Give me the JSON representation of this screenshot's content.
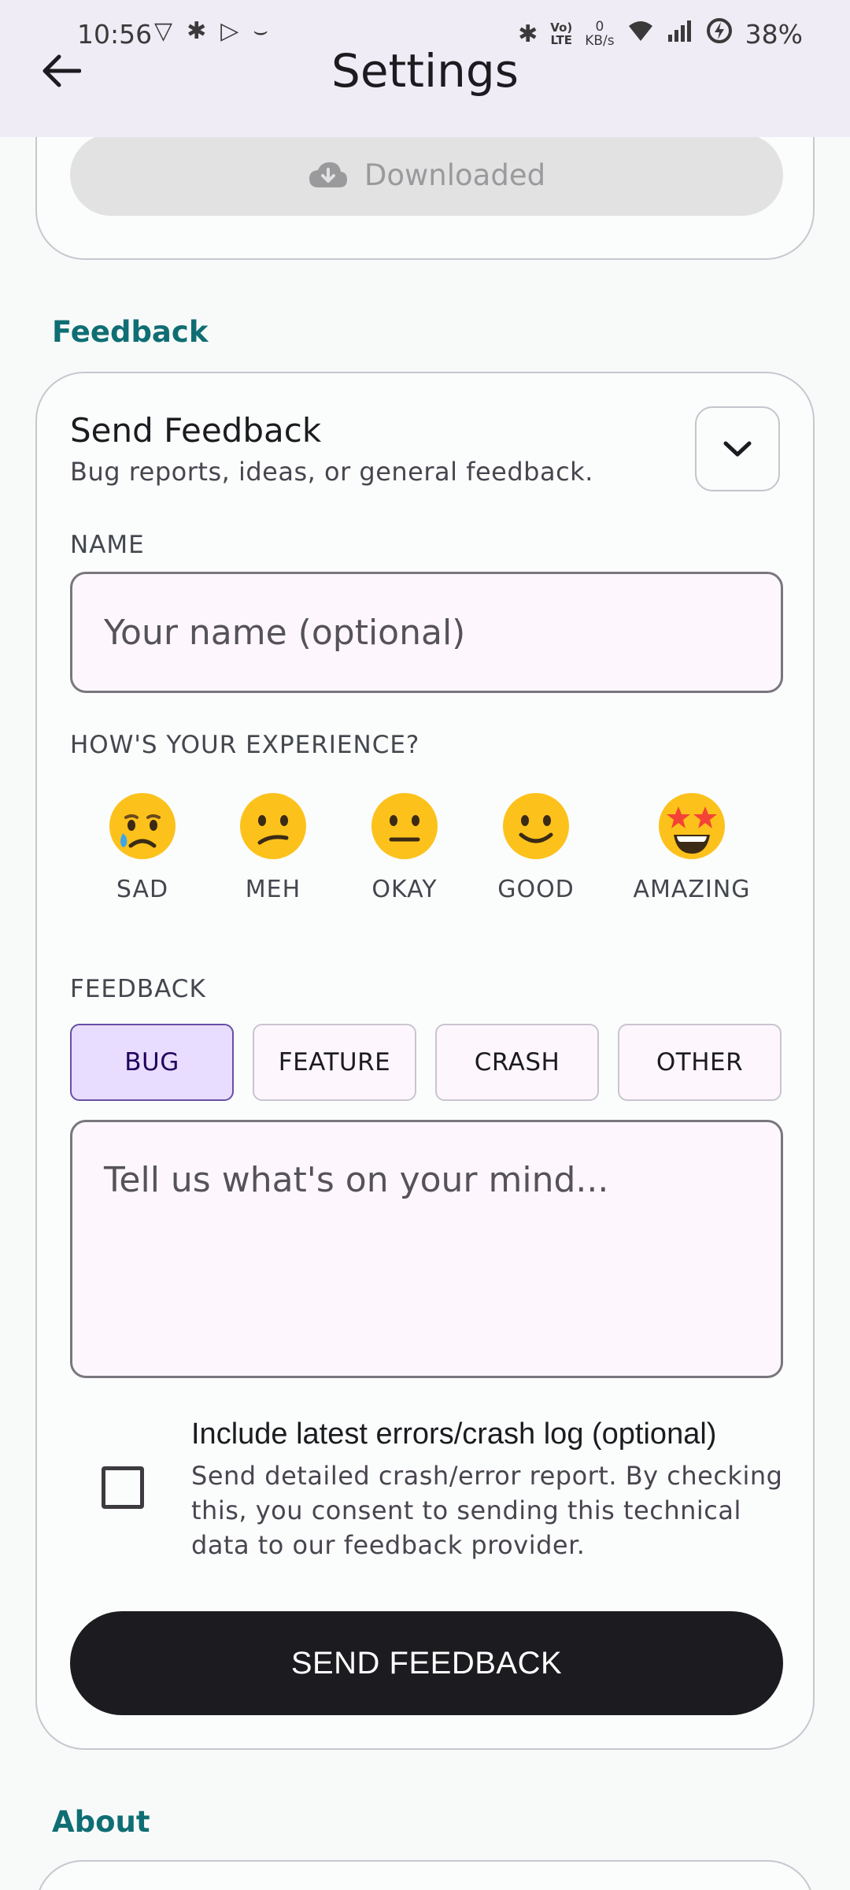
{
  "status_bar": {
    "time": "10:56",
    "net_speed_value": "0",
    "net_speed_unit": "KB/s",
    "volte_top": "Vo)",
    "volte_bottom": "LTE",
    "battery": "38%"
  },
  "app_bar": {
    "title": "Settings"
  },
  "download_card": {
    "button_label": "Downloaded"
  },
  "sections": {
    "feedback": "Feedback",
    "about": "About"
  },
  "feedback_card": {
    "title": "Send Feedback",
    "subtitle": "Bug reports, ideas, or general feedback.",
    "name_label": "NAME",
    "name_placeholder": "Your name (optional)",
    "experience_label": "HOW'S YOUR EXPERIENCE?",
    "experience_options": [
      {
        "label": "SAD",
        "icon": "sad-face-icon"
      },
      {
        "label": "MEH",
        "icon": "confused-face-icon"
      },
      {
        "label": "OKAY",
        "icon": "neutral-face-icon"
      },
      {
        "label": "GOOD",
        "icon": "smile-face-icon"
      },
      {
        "label": "AMAZING",
        "icon": "star-struck-face-icon"
      }
    ],
    "feedback_label": "FEEDBACK",
    "feedback_types": [
      {
        "label": "BUG",
        "selected": true
      },
      {
        "label": "FEATURE",
        "selected": false
      },
      {
        "label": "CRASH",
        "selected": false
      },
      {
        "label": "OTHER",
        "selected": false
      }
    ],
    "message_placeholder": "Tell us what's on your mind...",
    "include_log_title": "Include latest errors/crash log (optional)",
    "include_log_desc": "Send detailed crash/error report. By checking this, you consent to sending this technical data to our feedback provider.",
    "include_log_checked": false,
    "send_label": "SEND FEEDBACK"
  },
  "colors": {
    "accent_teal": "#0f6e73",
    "chip_selected": "#e9ddff",
    "send_button": "#1c1b1f",
    "app_bar_bg": "#f0ecf6"
  }
}
